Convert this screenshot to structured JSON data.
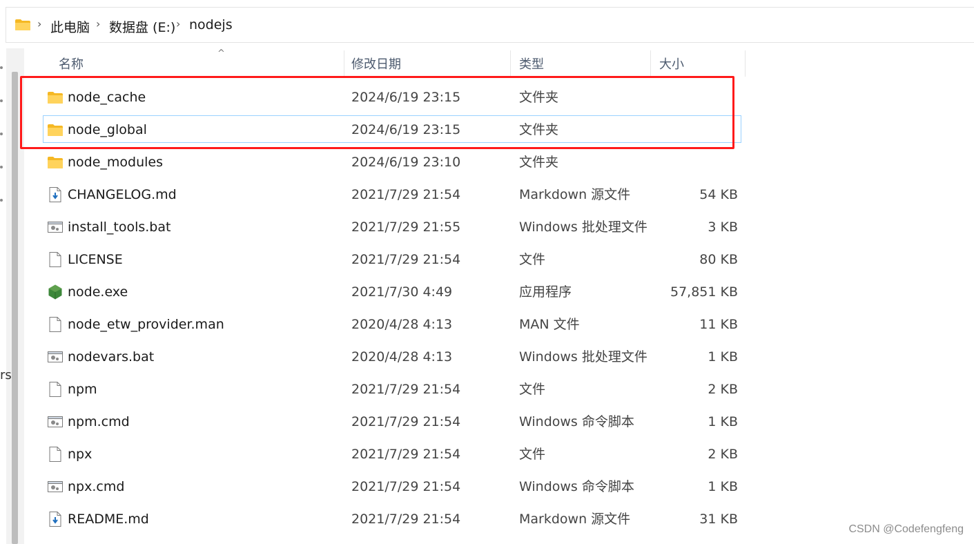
{
  "breadcrumb": {
    "items": [
      "此电脑",
      "数据盘 (E:)",
      "nodejs"
    ]
  },
  "left_pane": {
    "cut_text": "rs"
  },
  "columns": {
    "name": "名称",
    "date": "修改日期",
    "type": "类型",
    "size": "大小",
    "sort_indicator": "^"
  },
  "files": [
    {
      "name": "node_cache",
      "date": "2024/6/19 23:15",
      "type": "文件夹",
      "size": "",
      "icon": "folder-icon"
    },
    {
      "name": "node_global",
      "date": "2024/6/19 23:15",
      "type": "文件夹",
      "size": "",
      "icon": "folder-icon"
    },
    {
      "name": "node_modules",
      "date": "2024/6/19 23:10",
      "type": "文件夹",
      "size": "",
      "icon": "folder-icon"
    },
    {
      "name": "CHANGELOG.md",
      "date": "2021/7/29 21:54",
      "type": "Markdown 源文件",
      "size": "54 KB",
      "icon": "markdown-file-icon"
    },
    {
      "name": "install_tools.bat",
      "date": "2021/7/29 21:55",
      "type": "Windows 批处理文件",
      "size": "3 KB",
      "icon": "batch-file-icon"
    },
    {
      "name": "LICENSE",
      "date": "2021/7/29 21:54",
      "type": "文件",
      "size": "80 KB",
      "icon": "blank-file-icon"
    },
    {
      "name": "node.exe",
      "date": "2021/7/30 4:49",
      "type": "应用程序",
      "size": "57,851 KB",
      "icon": "nodejs-hexagon-icon"
    },
    {
      "name": "node_etw_provider.man",
      "date": "2020/4/28 4:13",
      "type": "MAN 文件",
      "size": "11 KB",
      "icon": "blank-file-icon"
    },
    {
      "name": "nodevars.bat",
      "date": "2020/4/28 4:13",
      "type": "Windows 批处理文件",
      "size": "1 KB",
      "icon": "batch-file-icon"
    },
    {
      "name": "npm",
      "date": "2021/7/29 21:54",
      "type": "文件",
      "size": "2 KB",
      "icon": "blank-file-icon"
    },
    {
      "name": "npm.cmd",
      "date": "2021/7/29 21:54",
      "type": "Windows 命令脚本",
      "size": "1 KB",
      "icon": "batch-file-icon"
    },
    {
      "name": "npx",
      "date": "2021/7/29 21:54",
      "type": "文件",
      "size": "2 KB",
      "icon": "blank-file-icon"
    },
    {
      "name": "npx.cmd",
      "date": "2021/7/29 21:54",
      "type": "Windows 命令脚本",
      "size": "1 KB",
      "icon": "batch-file-icon"
    },
    {
      "name": "README.md",
      "date": "2021/7/29 21:54",
      "type": "Markdown 源文件",
      "size": "31 KB",
      "icon": "markdown-file-icon"
    }
  ],
  "focused_index": 1,
  "colors": {
    "highlight_box": "#ff1a1a",
    "focus_border": "#99d1ff",
    "folder_yellow": "#ffc83d",
    "node_green": "#3c873a"
  },
  "watermark": "CSDN @Codefengfeng"
}
